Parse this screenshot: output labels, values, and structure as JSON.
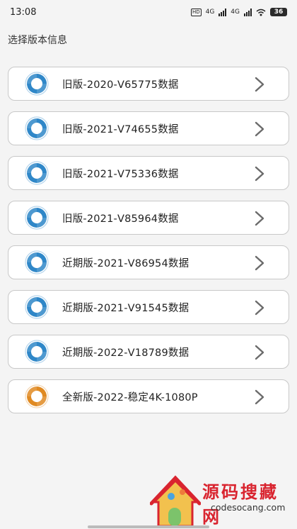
{
  "status_bar": {
    "time": "13:08",
    "hd_label": "HD",
    "net1": "4G",
    "net2": "4G",
    "battery": "36"
  },
  "page": {
    "title": "选择版本信息"
  },
  "versions": [
    {
      "label": "旧版-2020-V65775数据",
      "icon": "swirl-logo-icon",
      "color": "#2f87c8"
    },
    {
      "label": "旧版-2021-V74655数据",
      "icon": "swirl-logo-icon",
      "color": "#2f87c8"
    },
    {
      "label": "旧版-2021-V75336数据",
      "icon": "swirl-logo-icon",
      "color": "#2f87c8"
    },
    {
      "label": "旧版-2021-V85964数据",
      "icon": "swirl-logo-icon",
      "color": "#2f87c8"
    },
    {
      "label": "近期版-2021-V86954数据",
      "icon": "swirl-logo-icon",
      "color": "#2f87c8"
    },
    {
      "label": "近期版-2021-V91545数据",
      "icon": "swirl-logo-icon",
      "color": "#2f87c8"
    },
    {
      "label": "近期版-2022-V18789数据",
      "icon": "swirl-logo-icon",
      "color": "#2f87c8"
    },
    {
      "label": "全新版-2022-稳定4K-1080P",
      "icon": "swirl-logo-icon",
      "color": "#e08a22"
    }
  ],
  "watermark": {
    "text": "源码搜藏网",
    "url": "codesocang.com"
  }
}
